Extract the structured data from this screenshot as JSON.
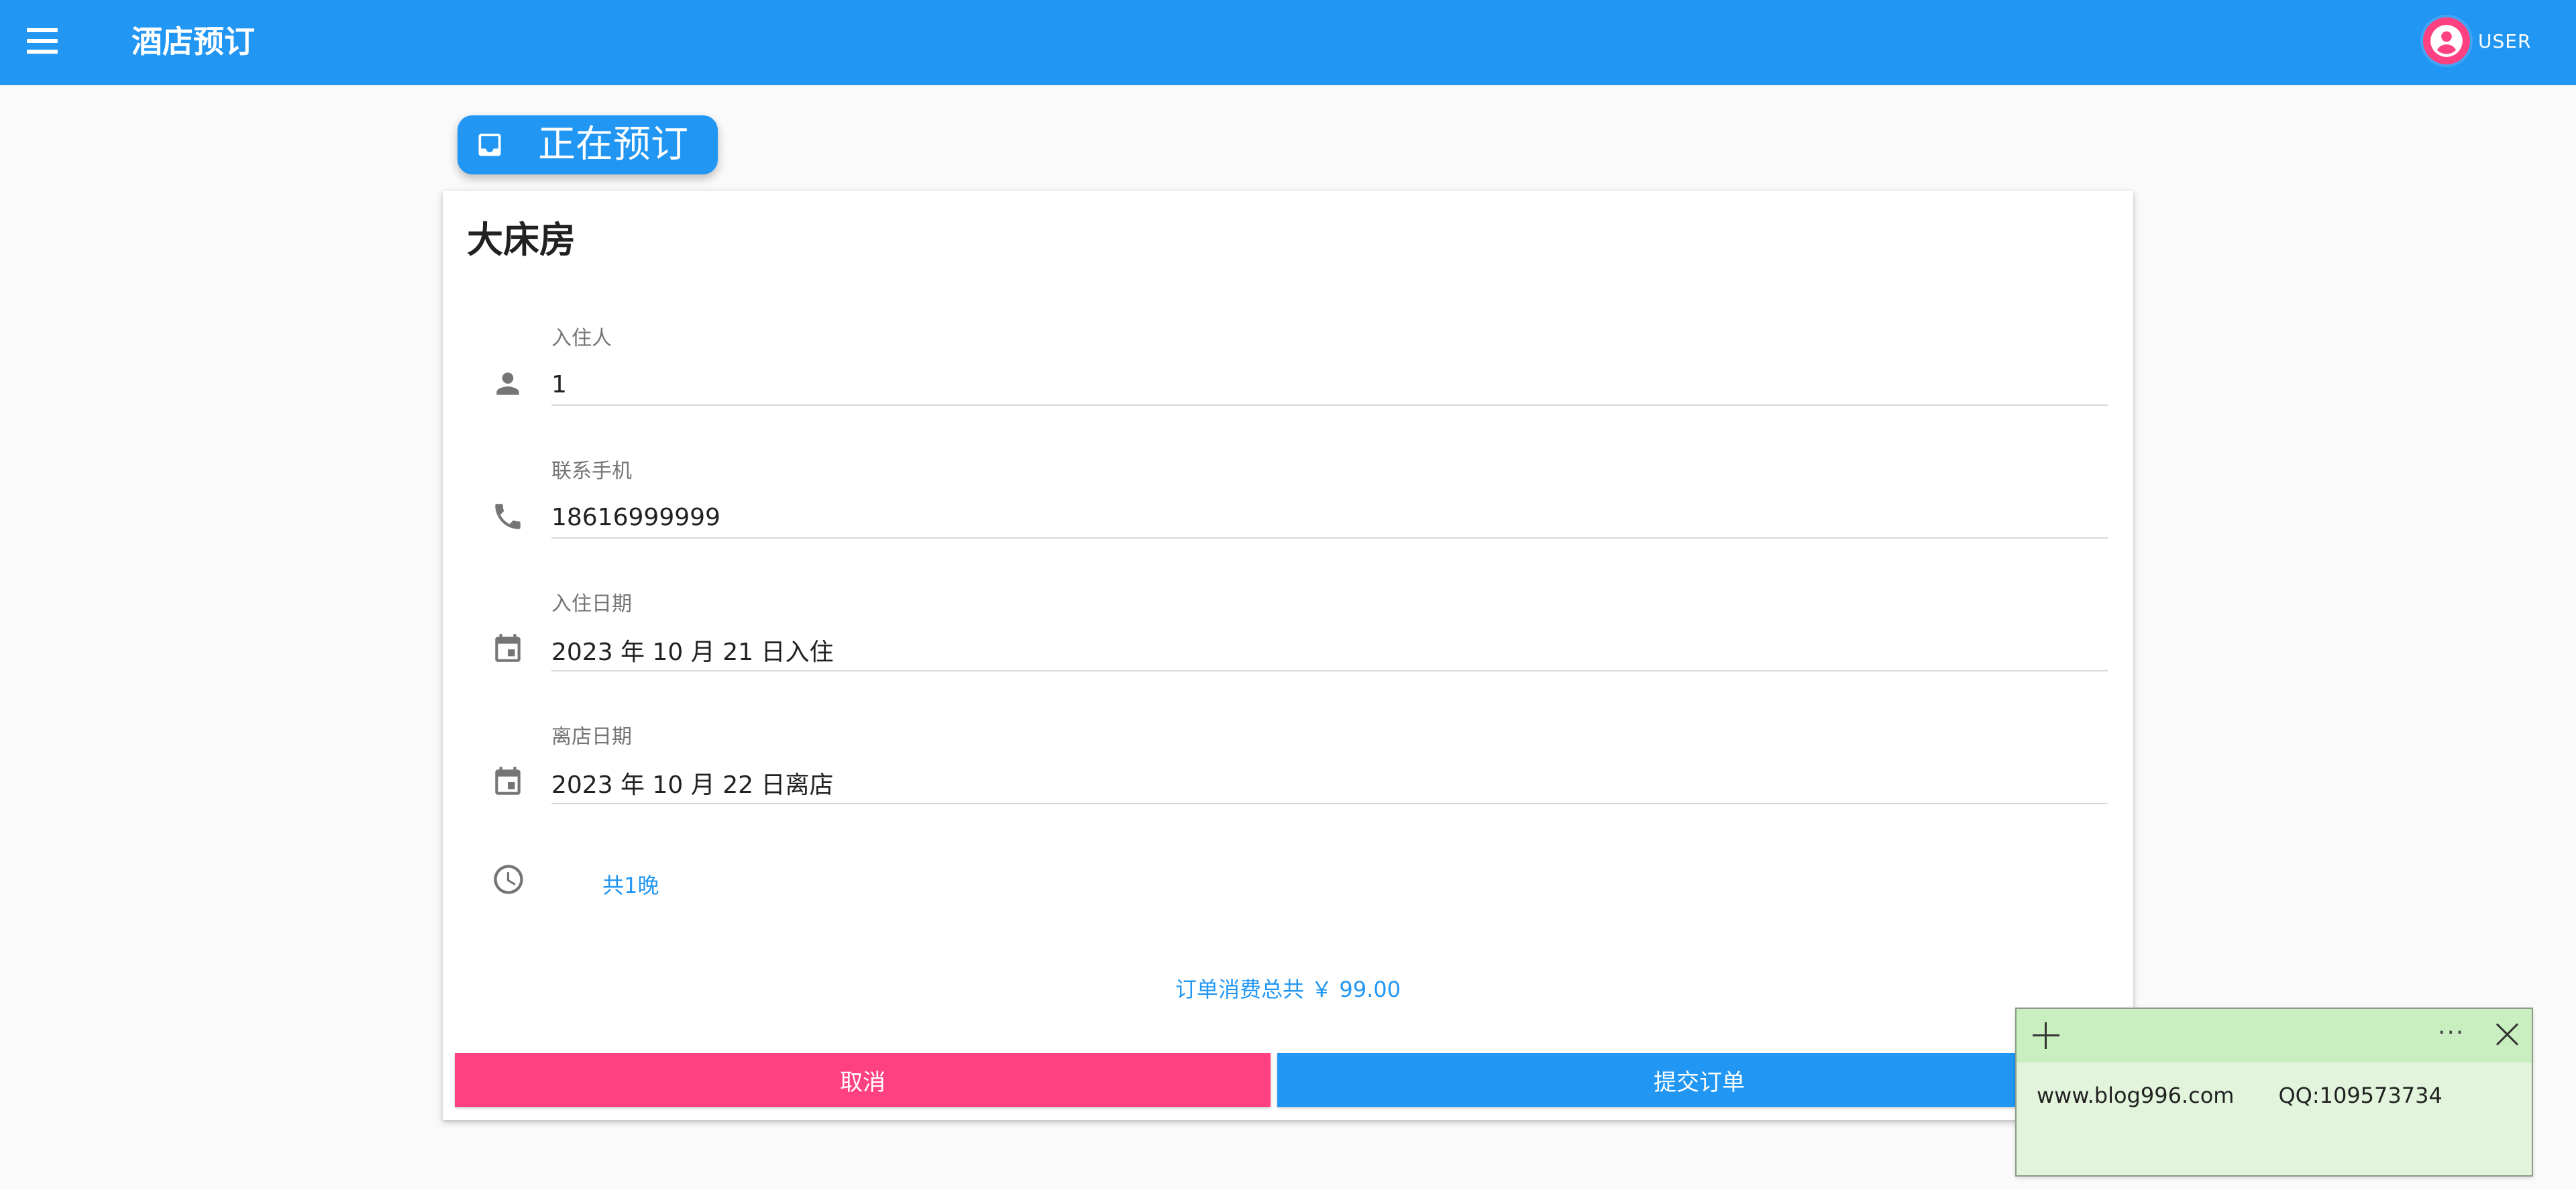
{
  "appbar": {
    "title": "酒店预订",
    "menu_icon": "menu-icon",
    "user_label": "USER",
    "user_icon": "account-circle-icon",
    "accent": "#2196f3",
    "avatar_color": "#ff4081"
  },
  "status_chip": {
    "label": "正在预订",
    "icon": "inbox-icon"
  },
  "booking": {
    "room_name": "大床房",
    "fields": {
      "guest": {
        "label": "入住人",
        "value": "1",
        "icon": "person-icon"
      },
      "phone": {
        "label": "联系手机",
        "value": "18616999999",
        "icon": "phone-icon"
      },
      "checkin": {
        "label": "入住日期",
        "value": "2023 年 10 月 21 日入住",
        "icon": "calendar-icon"
      },
      "checkout": {
        "label": "离店日期",
        "value": "2023 年 10 月 22 日离店",
        "icon": "calendar-icon"
      }
    },
    "nights": {
      "text": "共1晚",
      "icon": "clock-icon"
    },
    "total": "订单消费总共 ￥ 99.00",
    "actions": {
      "cancel_label": "取消",
      "submit_label": "提交订单",
      "cancel_color": "#ff4081",
      "submit_color": "#2196f3"
    }
  },
  "sticky_note": {
    "website": "www.blog996.com",
    "qq": "QQ:109573734",
    "more_label": "···",
    "background": "#e2f5dc"
  }
}
